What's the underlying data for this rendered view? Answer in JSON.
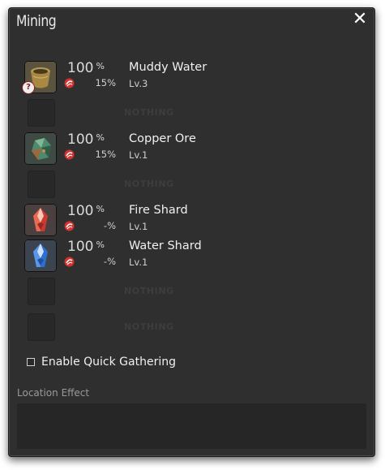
{
  "window": {
    "title": "Mining",
    "close_icon": "close-icon"
  },
  "items": [
    {
      "type": "item",
      "name": "Muddy Water",
      "level": "Lv.3",
      "chance": "100",
      "chance_unit": "%",
      "hq_chance": "15%",
      "icon": "muddy-water-icon",
      "has_badge": true,
      "badge_text": "?"
    },
    {
      "type": "empty",
      "label": "NOTHING"
    },
    {
      "type": "item",
      "name": "Copper Ore",
      "level": "Lv.1",
      "chance": "100",
      "chance_unit": "%",
      "hq_chance": "15%",
      "icon": "copper-ore-icon"
    },
    {
      "type": "empty",
      "label": "NOTHING"
    },
    {
      "type": "item",
      "name": "Fire Shard",
      "level": "Lv.1",
      "chance": "100",
      "chance_unit": "%",
      "hq_chance": "-%",
      "icon": "fire-shard-icon"
    },
    {
      "type": "item",
      "name": "Water Shard",
      "level": "Lv.1",
      "chance": "100",
      "chance_unit": "%",
      "hq_chance": "-%",
      "icon": "water-shard-icon"
    },
    {
      "type": "empty",
      "label": "NOTHING"
    },
    {
      "type": "empty",
      "label": "NOTHING"
    }
  ],
  "quick_gathering": {
    "label": "Enable Quick Gathering",
    "checked": false
  },
  "location_effect": {
    "title": "Location Effect"
  },
  "colors": {
    "window_bg": "#2f2f2f",
    "hq_red": "#d4322c",
    "text": "#f0f0f0"
  }
}
